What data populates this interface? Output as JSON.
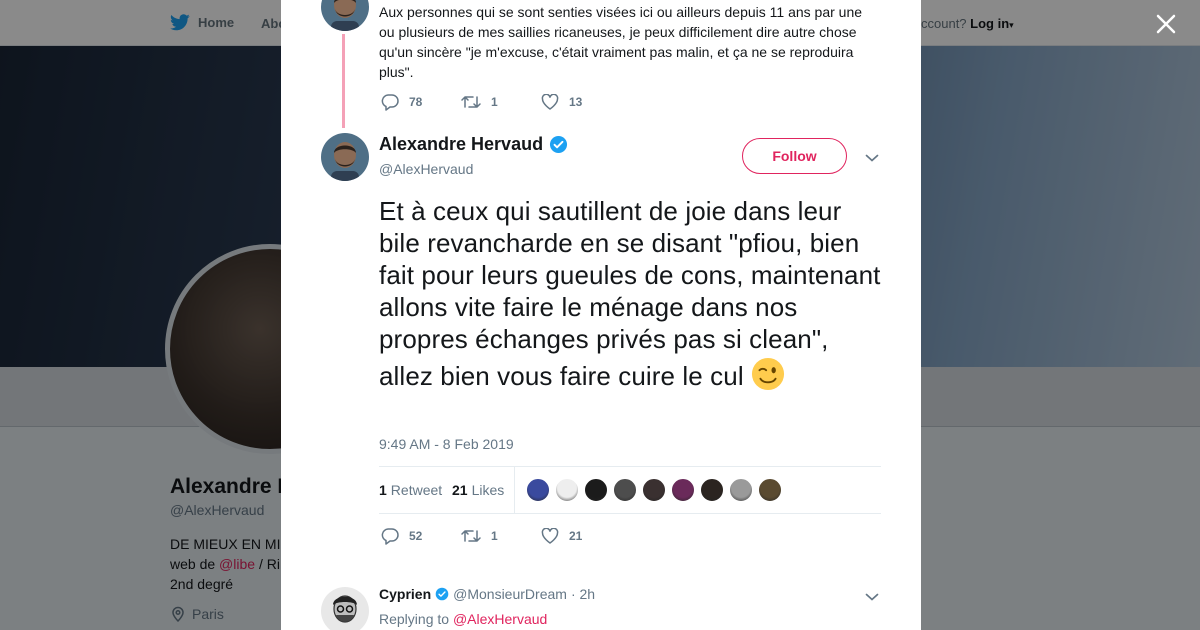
{
  "background_page": {
    "nav": {
      "home_label": "Home",
      "about_label": "Abo",
      "account_prompt": "ccount?",
      "login_label": "Log in"
    },
    "profile": {
      "name": "Alexandre H",
      "handle": "@AlexHervaud",
      "bio_line1": "DE MIEUX EN MI",
      "bio_line2_pre": "web de ",
      "bio_link": "@libe",
      "bio_line2_post": " / Ri",
      "bio_line3": "2nd degré",
      "location": "Paris"
    }
  },
  "previous_tweet": {
    "text": "Aux personnes qui se sont senties visées ici ou ailleurs depuis 11 ans par une ou plusieurs de mes saillies ricaneuses, je peux difficilement dire autre chose qu'un sincère \"je m'excuse, c'était vraiment pas malin, et ça ne se reproduira plus\".",
    "replies": "78",
    "retweets": "1",
    "likes": "13"
  },
  "main_tweet": {
    "author_name": "Alexandre Hervaud",
    "author_handle": "@AlexHervaud",
    "follow_label": "Follow",
    "text": "Et à ceux qui sautillent de joie dans leur bile revancharde en se disant \"pfiou, bien fait pour leurs gueules de cons, maintenant allons vite faire le ménage dans nos propres échanges privés pas si clean\", allez bien vous faire cuire le cul",
    "emoji": "winking-face",
    "timestamp": "9:49 AM - 8 Feb 2019",
    "retweet_count": "1",
    "retweet_label": "Retweet",
    "likes_count": "21",
    "likes_label": "Likes",
    "liker_colors": [
      "#3a4a9e",
      "#eeeeee",
      "#1b1b1b",
      "#4d4d4d",
      "#3a3030",
      "#6a2a5a",
      "#2b2420",
      "#9a9a9a",
      "#5a4a30"
    ],
    "replies": "52",
    "retweets": "1",
    "likes": "21"
  },
  "reply_tweet": {
    "author_name": "Cyprien",
    "author_handle": "@MonsieurDream",
    "time": "· 2h",
    "replying_label": "Replying to",
    "replying_to": "@AlexHervaud"
  },
  "colors": {
    "accent": "#e0245e",
    "verified": "#1da1f2",
    "secondary_text": "#657786",
    "thread_line": "#f4a1b7"
  }
}
